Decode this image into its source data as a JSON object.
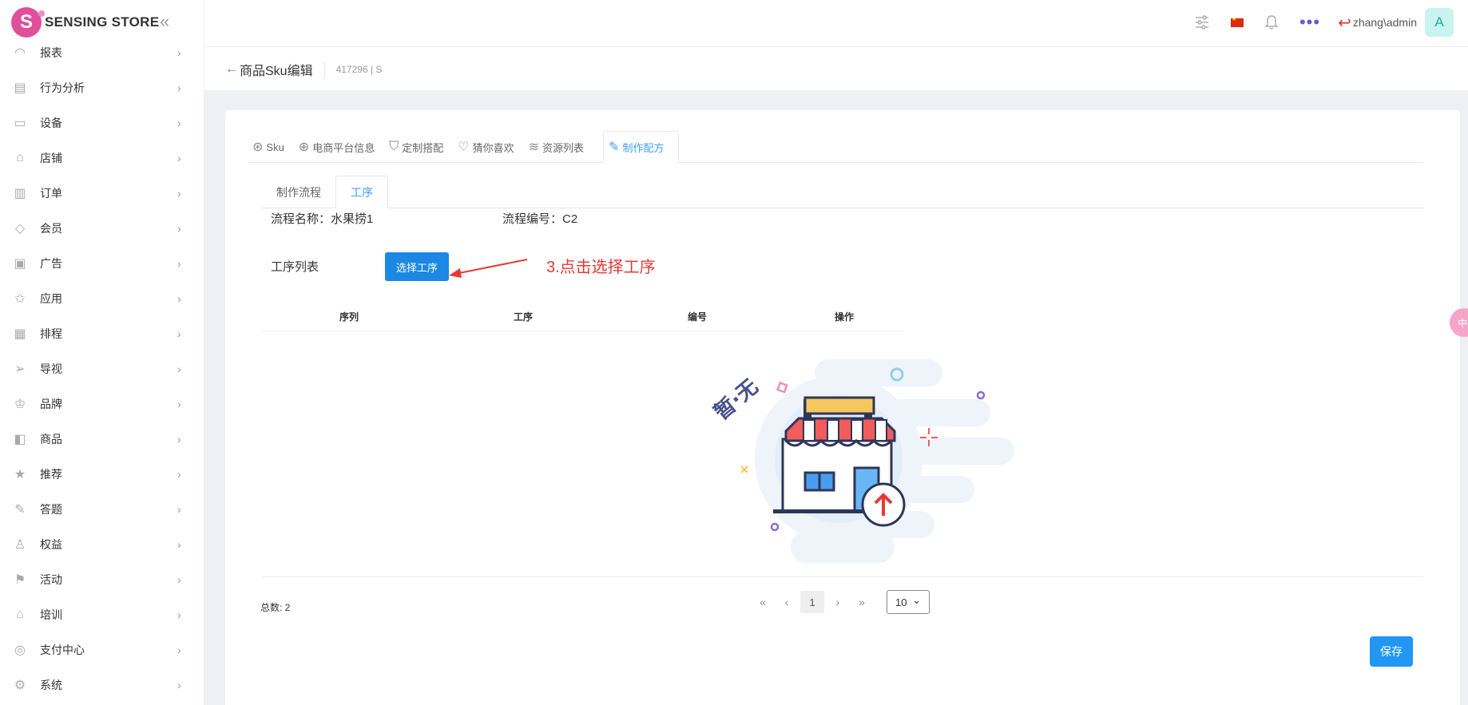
{
  "brand": {
    "name": "SENSING STORE",
    "logo_letter": "S",
    "accent": "#e0509a"
  },
  "sidebar": {
    "collapse_icon": "double-chevron-left-icon",
    "items": [
      {
        "label": "报表",
        "icon": "dashboard-icon"
      },
      {
        "label": "行为分析",
        "icon": "document-icon"
      },
      {
        "label": "设备",
        "icon": "device-icon"
      },
      {
        "label": "店铺",
        "icon": "store-icon"
      },
      {
        "label": "订单",
        "icon": "clipboard-icon"
      },
      {
        "label": "会员",
        "icon": "diamond-icon"
      },
      {
        "label": "广告",
        "icon": "ad-icon"
      },
      {
        "label": "应用",
        "icon": "app-icon"
      },
      {
        "label": "排程",
        "icon": "schedule-icon"
      },
      {
        "label": "导视",
        "icon": "navigation-icon"
      },
      {
        "label": "品牌",
        "icon": "crown-icon"
      },
      {
        "label": "商品",
        "icon": "box-icon"
      },
      {
        "label": "推荐",
        "icon": "star-icon"
      },
      {
        "label": "答题",
        "icon": "edit-icon"
      },
      {
        "label": "权益",
        "icon": "user-icon"
      },
      {
        "label": "活动",
        "icon": "flag-icon"
      },
      {
        "label": "培训",
        "icon": "graduation-icon"
      },
      {
        "label": "支付中心",
        "icon": "payment-icon"
      },
      {
        "label": "系统",
        "icon": "settings-icon"
      }
    ]
  },
  "header": {
    "user_name": "zhang\\admin",
    "avatar_letter": "A",
    "flag_color": "#de2910"
  },
  "page": {
    "back_arrow": "←",
    "title": "商品Sku编辑",
    "subtitle": "417296 | S"
  },
  "tabs": [
    {
      "label": "Sku",
      "icon": "sku-icon",
      "active": false
    },
    {
      "label": "电商平台信息",
      "icon": "globe-icon",
      "active": false
    },
    {
      "label": "定制搭配",
      "icon": "shirt-icon",
      "active": false
    },
    {
      "label": "猜你喜欢",
      "icon": "heart-icon",
      "active": false
    },
    {
      "label": "资源列表",
      "icon": "layers-icon",
      "active": false
    },
    {
      "label": "制作配方",
      "icon": "edit-icon",
      "active": true
    }
  ],
  "subtabs": [
    {
      "label": "制作流程",
      "active": false
    },
    {
      "label": "工序",
      "active": true
    }
  ],
  "flow": {
    "name_label": "流程名称：水果捞1",
    "code_label": "流程编号：C2"
  },
  "process": {
    "list_label": "工序列表",
    "select_button": "选择工序",
    "annotation": "3.点击选择工序",
    "annotation_color": "#e53935"
  },
  "table": {
    "columns": [
      "序列",
      "工序",
      "编号",
      "操作"
    ],
    "rows": [],
    "empty_text": "暂·无"
  },
  "pagination": {
    "total_label": "总数: 2",
    "current_page": "1",
    "page_size": "10"
  },
  "footer": {
    "save_button": "保存"
  },
  "floating": {
    "label": "中"
  }
}
